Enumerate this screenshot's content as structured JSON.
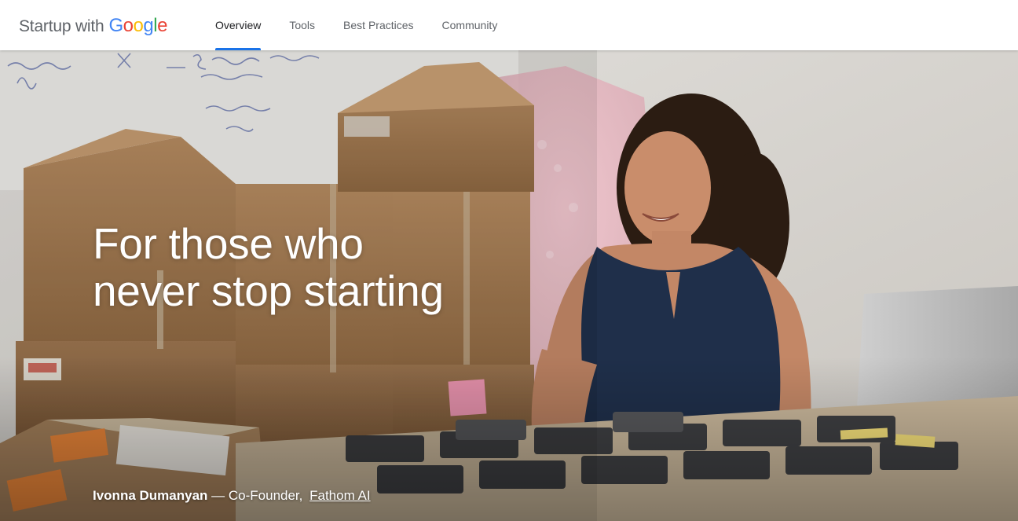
{
  "header": {
    "logo": {
      "prefix": "Startup with",
      "brand_letters": [
        {
          "char": "G",
          "color": "#4285F4"
        },
        {
          "char": "o",
          "color": "#EA4335"
        },
        {
          "char": "o",
          "color": "#FBBC05"
        },
        {
          "char": "g",
          "color": "#4285F4"
        },
        {
          "char": "l",
          "color": "#34A853"
        },
        {
          "char": "e",
          "color": "#EA4335"
        }
      ]
    },
    "nav": [
      {
        "label": "Overview",
        "active": true
      },
      {
        "label": "Tools",
        "active": false
      },
      {
        "label": "Best Practices",
        "active": false
      },
      {
        "label": "Community",
        "active": false
      }
    ],
    "accent_color": "#1a73e8"
  },
  "hero": {
    "title_line1": "For those who",
    "title_line2": "never stop starting",
    "credit": {
      "name": "Ivonna Dumanyan",
      "separator": "— Co-Founder,",
      "company": "Fathom AI"
    },
    "image_description_icon": "photo-startup-founder"
  }
}
